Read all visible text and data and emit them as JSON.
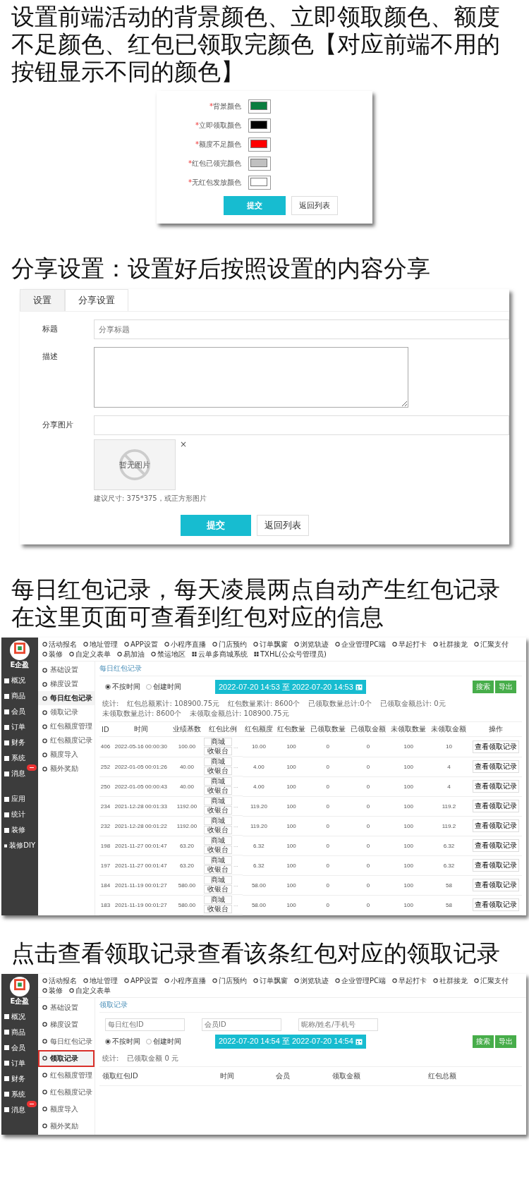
{
  "sections": [
    {
      "kind": "colors",
      "heading": "设置前端活动的背景颜色、立即领取颜色、额度不足颜色、红包已领取完颜色【对应前端不用的按钮显示不同的颜色】",
      "color_rows": [
        {
          "marker": "*",
          "label": "背景颜色",
          "color": "#0b7d40"
        },
        {
          "marker": "*",
          "label": "立即领取颜色",
          "color": "#000000"
        },
        {
          "marker": "*",
          "label": "额度不足颜色",
          "color": "#ff0000"
        },
        {
          "marker": "*",
          "label": "红包已领完颜色",
          "color": "#c0c0c0"
        },
        {
          "marker": "*",
          "label": "无红包发放颜色",
          "color": "#ffffff"
        }
      ],
      "buttons": [
        "提交",
        "返回列表"
      ]
    },
    {
      "kind": "share",
      "heading": "分享设置：设置好后按照设置的内容分享",
      "tabs": [
        {
          "label": "设置",
          "selected": false
        },
        {
          "label": "分享设置",
          "selected": true
        }
      ],
      "title_label": "标题",
      "title_placeholder": "分享标题",
      "desc_label": "描述",
      "image_label": "分享图片",
      "image_empty": "暂无图片",
      "remove_icon": "×",
      "hint": "建议尺寸: 375*375，或正方形图片",
      "buttons": [
        "提交",
        "返回列表"
      ]
    },
    {
      "kind": "admin",
      "heading": "每日红包记录，每天凌晨两点自动产生红包记录在这里页面可查看到红包对应的信息",
      "screen": {
        "logo_text": "E企盈",
        "nav": [
          "活动报名",
          "地址管理",
          "APP设置",
          "小程序直播",
          "门店预约",
          "订单飘窗",
          "浏览轨迹",
          "企业管理PC端",
          "早起打卡",
          "社群接龙",
          "汇聚支付",
          "装修",
          "自定义表单",
          "易加油",
          "禁运地区"
        ],
        "nav_right": [
          "云单多商城系统",
          "TXHL(公众号管理员)"
        ],
        "sidebar_groups": [
          {
            "items": [
              {
                "label": "概况",
                "badge": false
              },
              {
                "label": "商品",
                "badge": false
              },
              {
                "label": "会员",
                "badge": false
              },
              {
                "label": "订单",
                "badge": false
              },
              {
                "label": "财务",
                "badge": false
              },
              {
                "label": "系统",
                "badge": false
              },
              {
                "label": "消息",
                "badge": true
              }
            ]
          },
          {
            "items": [
              {
                "label": "应用",
                "badge": false
              },
              {
                "label": "统计",
                "badge": false
              },
              {
                "label": "装修",
                "badge": false
              },
              {
                "label": "装修DIY",
                "badge": false
              }
            ]
          }
        ],
        "subnav": [
          {
            "label": "基础设置",
            "selected": false
          },
          {
            "label": "梯度设置",
            "selected": false
          },
          {
            "label": "每日红包记录",
            "selected": true
          },
          {
            "label": "领取记录",
            "selected": false
          },
          {
            "label": "红包额度管理",
            "selected": false
          },
          {
            "label": "红包额度记录",
            "selected": false
          },
          {
            "label": "额度导入",
            "selected": false
          },
          {
            "label": "额外奖励",
            "selected": false
          }
        ],
        "breadcrumb": "每日红包记录",
        "time_filter": [
          {
            "label": "不按时间",
            "selected": true
          },
          {
            "label": "创建时间",
            "selected": false
          }
        ],
        "date_range": "2022-07-20 14:53 至 2022-07-20 14:53",
        "actions": [
          "搜索",
          "导出"
        ],
        "stats": [
          "统计:",
          "红包总额累计: 108900.75元",
          "红包数量累计: 8600个",
          "已领取数量总计:0个",
          "已领取金额总计: 0元",
          "未领取数量总计: 8600个",
          "未领取金额总计: 108900.75元"
        ],
        "table": {
          "columns": [
            "ID",
            "时间",
            "业绩基数",
            "红包比例",
            "红包额度",
            "红包数量",
            "已领取数量",
            "已领取金额",
            "未领取数量",
            "未领取金额",
            "操作"
          ],
          "rows": [
            {
              "cells": [
                "406",
                "2022-05-16 00:00:30",
                "100.00"
              ],
              "ratio_tags": [
                "商城",
                "收银台"
              ],
              "ratio_more": "...",
              "cells2": [
                "10.00",
                "100",
                "0",
                "0",
                "100",
                "10"
              ],
              "action": "查看领取记录"
            },
            {
              "cells": [
                "252",
                "2022-01-05 00:01:26",
                "40.00"
              ],
              "ratio_tags": [
                "商城",
                "收银台"
              ],
              "ratio_more": "...",
              "cells2": [
                "4.00",
                "100",
                "0",
                "0",
                "100",
                "4"
              ],
              "action": "查看领取记录"
            },
            {
              "cells": [
                "250",
                "2022-01-05 00:00:43",
                "40.00"
              ],
              "ratio_tags": [
                "商城",
                "收银台"
              ],
              "ratio_more": "...",
              "cells2": [
                "4.00",
                "100",
                "0",
                "0",
                "100",
                "4"
              ],
              "action": "查看领取记录"
            },
            {
              "cells": [
                "234",
                "2021-12-28 00:01:33",
                "1192.00"
              ],
              "ratio_tags": [
                "商城",
                "收银台"
              ],
              "ratio_more": "...",
              "cells2": [
                "119.20",
                "100",
                "0",
                "0",
                "100",
                "119.2"
              ],
              "action": "查看领取记录"
            },
            {
              "cells": [
                "232",
                "2021-12-28 00:01:22",
                "1192.00"
              ],
              "ratio_tags": [
                "商城",
                "收银台"
              ],
              "ratio_more": "...",
              "cells2": [
                "119.20",
                "100",
                "0",
                "0",
                "100",
                "119.2"
              ],
              "action": "查看领取记录"
            },
            {
              "cells": [
                "198",
                "2021-11-27 00:01:47",
                "63.20"
              ],
              "ratio_tags": [
                "商城",
                "收银台"
              ],
              "ratio_more": "...",
              "cells2": [
                "6.32",
                "100",
                "0",
                "0",
                "100",
                "6.32"
              ],
              "action": "查看领取记录"
            },
            {
              "cells": [
                "197",
                "2021-11-27 00:01:47",
                "63.20"
              ],
              "ratio_tags": [
                "商城",
                "收银台"
              ],
              "ratio_more": "...",
              "cells2": [
                "6.32",
                "100",
                "0",
                "0",
                "100",
                "6.32"
              ],
              "action": "查看领取记录"
            },
            {
              "cells": [
                "184",
                "2021-11-19 00:01:27",
                "580.00"
              ],
              "ratio_tags": [
                "商城",
                "收银台"
              ],
              "ratio_more": "...",
              "cells2": [
                "58.00",
                "100",
                "0",
                "0",
                "100",
                "58"
              ],
              "action": "查看领取记录"
            },
            {
              "cells": [
                "183",
                "2021-11-19 00:01:27",
                "580.00"
              ],
              "ratio_tags": [
                "商城",
                "收银台"
              ],
              "ratio_more": "...",
              "cells2": [
                "58.00",
                "100",
                "0",
                "0",
                "100",
                "58"
              ],
              "action": "查看领取记录"
            }
          ]
        }
      }
    },
    {
      "kind": "admin",
      "heading": "点击查看领取记录查看该条红包对应的领取记录",
      "screen": {
        "logo_text": "E企盈",
        "nav": [
          "活动报名",
          "地址管理",
          "APP设置",
          "小程序直播",
          "门店预约",
          "订单飘窗",
          "浏览轨迹",
          "企业管理PC端",
          "早起打卡",
          "社群接龙",
          "汇聚支付",
          "装修",
          "自定义表单"
        ],
        "sidebar_groups": [
          {
            "items": [
              {
                "label": "概况",
                "badge": false
              },
              {
                "label": "商品",
                "badge": false
              },
              {
                "label": "会员",
                "badge": false
              },
              {
                "label": "订单",
                "badge": false
              },
              {
                "label": "财务",
                "badge": false
              },
              {
                "label": "系统",
                "badge": false
              },
              {
                "label": "消息",
                "badge": true
              }
            ]
          }
        ],
        "subnav": [
          {
            "label": "基础设置",
            "selected": false,
            "highlighted": false
          },
          {
            "label": "梯度设置",
            "selected": false,
            "highlighted": false
          },
          {
            "label": "每日红包记录",
            "selected": false,
            "highlighted": false
          },
          {
            "label": "领取记录",
            "selected": true,
            "highlighted": true
          },
          {
            "label": "红包额度管理",
            "selected": false,
            "highlighted": false
          },
          {
            "label": "红包额度记录",
            "selected": false,
            "highlighted": false
          },
          {
            "label": "额度导入",
            "selected": false,
            "highlighted": false
          },
          {
            "label": "额外奖励",
            "selected": false,
            "highlighted": false
          }
        ],
        "breadcrumb": "领取记录",
        "search_fields": [
          {
            "placeholder": "每日红包ID"
          },
          {
            "placeholder": "会员ID"
          },
          {
            "placeholder": "昵称/姓名/手机号"
          }
        ],
        "time_filter": [
          {
            "label": "不按时间",
            "selected": true
          },
          {
            "label": "创建时间",
            "selected": false
          }
        ],
        "date_range": "2022-07-20 14:54 至 2022-07-20 14:54",
        "actions": [
          "搜索",
          "导出"
        ],
        "stats": [
          "统计:",
          "已领取金额 0 元"
        ],
        "table": {
          "columns": [
            "领取红包ID",
            "时间",
            "会员",
            "领取金额",
            "红包总额"
          ]
        }
      }
    }
  ]
}
